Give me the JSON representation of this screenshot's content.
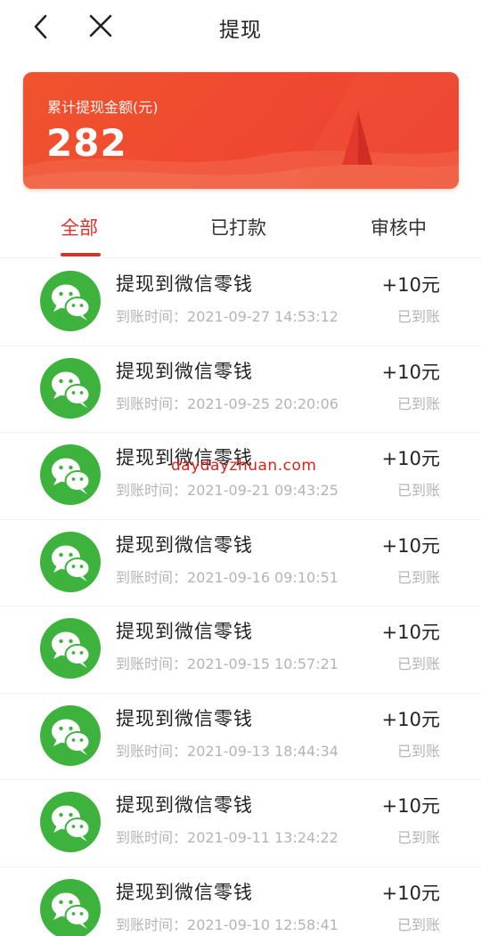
{
  "header": {
    "title": "提现",
    "back_icon": "chevron-left-icon",
    "close_icon": "close-icon"
  },
  "summary": {
    "label": "累计提现金额(元)",
    "amount": "282"
  },
  "tabs": [
    {
      "label": "全部",
      "active": true
    },
    {
      "label": "已打款",
      "active": false
    },
    {
      "label": "审核中",
      "active": false
    }
  ],
  "colors": {
    "accent": "#d7322a",
    "card": "#f04a30",
    "wechat_green": "#3db33d"
  },
  "records": [
    {
      "title": "提现到微信零钱",
      "time_label": "到账时间：",
      "time": "2021-09-27 14:53:12",
      "amount": "+10元",
      "status": "已到账"
    },
    {
      "title": "提现到微信零钱",
      "time_label": "到账时间：",
      "time": "2021-09-25 20:20:06",
      "amount": "+10元",
      "status": "已到账"
    },
    {
      "title": "提现到微信零钱",
      "time_label": "到账时间：",
      "time": "2021-09-21 09:43:25",
      "amount": "+10元",
      "status": "已到账"
    },
    {
      "title": "提现到微信零钱",
      "time_label": "到账时间：",
      "time": "2021-09-16 09:10:51",
      "amount": "+10元",
      "status": "已到账"
    },
    {
      "title": "提现到微信零钱",
      "time_label": "到账时间：",
      "time": "2021-09-15 10:57:21",
      "amount": "+10元",
      "status": "已到账"
    },
    {
      "title": "提现到微信零钱",
      "time_label": "到账时间：",
      "time": "2021-09-13 18:44:34",
      "amount": "+10元",
      "status": "已到账"
    },
    {
      "title": "提现到微信零钱",
      "time_label": "到账时间：",
      "time": "2021-09-11 13:24:22",
      "amount": "+10元",
      "status": "已到账"
    },
    {
      "title": "提现到微信零钱",
      "time_label": "到账时间：",
      "time": "2021-09-10 12:58:41",
      "amount": "+10元",
      "status": "已到账"
    }
  ],
  "watermark": "daydayzhuan.com"
}
